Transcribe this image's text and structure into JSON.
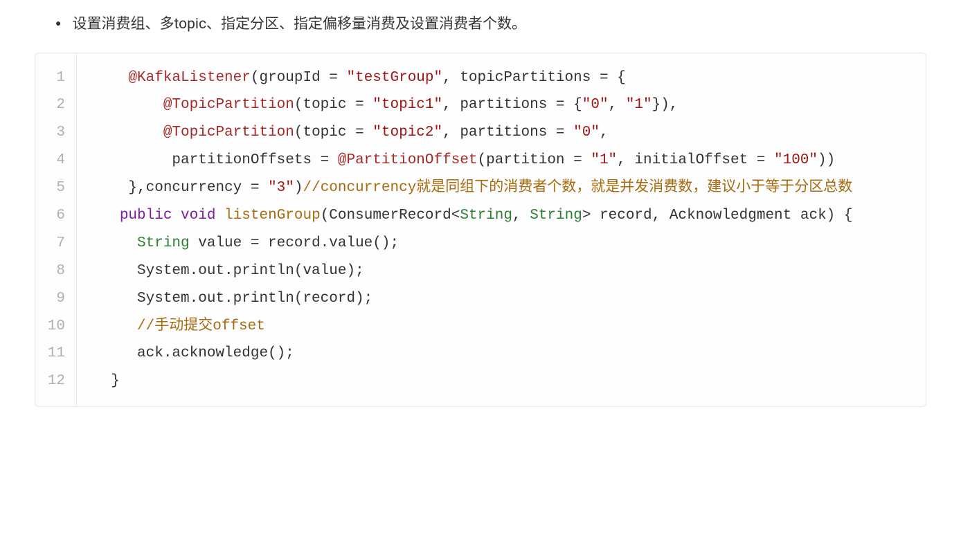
{
  "bullet_text": "设置消费组、多topic、指定分区、指定偏移量消费及设置消费者个数。",
  "code": {
    "line_numbers": [
      "1",
      "2",
      "3",
      "4",
      "5",
      "6",
      "7",
      "8",
      "9",
      "10",
      "11",
      "12"
    ],
    "lines": [
      [
        {
          "cls": "tk-plain",
          "text": "    "
        },
        {
          "cls": "tk-annotation",
          "text": "@KafkaListener"
        },
        {
          "cls": "tk-plain",
          "text": "(groupId = "
        },
        {
          "cls": "tk-string",
          "text": "\"testGroup\""
        },
        {
          "cls": "tk-plain",
          "text": ", topicPartitions = {"
        }
      ],
      [
        {
          "cls": "tk-plain",
          "text": "        "
        },
        {
          "cls": "tk-annotation",
          "text": "@TopicPartition"
        },
        {
          "cls": "tk-plain",
          "text": "(topic = "
        },
        {
          "cls": "tk-string",
          "text": "\"topic1\""
        },
        {
          "cls": "tk-plain",
          "text": ", partitions = {"
        },
        {
          "cls": "tk-string",
          "text": "\"0\""
        },
        {
          "cls": "tk-plain",
          "text": ", "
        },
        {
          "cls": "tk-string",
          "text": "\"1\""
        },
        {
          "cls": "tk-plain",
          "text": "}),"
        }
      ],
      [
        {
          "cls": "tk-plain",
          "text": "        "
        },
        {
          "cls": "tk-annotation",
          "text": "@TopicPartition"
        },
        {
          "cls": "tk-plain",
          "text": "(topic = "
        },
        {
          "cls": "tk-string",
          "text": "\"topic2\""
        },
        {
          "cls": "tk-plain",
          "text": ", partitions = "
        },
        {
          "cls": "tk-string",
          "text": "\"0\""
        },
        {
          "cls": "tk-plain",
          "text": ","
        }
      ],
      [
        {
          "cls": "tk-plain",
          "text": "         partitionOffsets = "
        },
        {
          "cls": "tk-annotation",
          "text": "@PartitionOffset"
        },
        {
          "cls": "tk-plain",
          "text": "(partition = "
        },
        {
          "cls": "tk-string",
          "text": "\"1\""
        },
        {
          "cls": "tk-plain",
          "text": ", initialOffset = "
        },
        {
          "cls": "tk-string",
          "text": "\"100\""
        },
        {
          "cls": "tk-plain",
          "text": "))"
        }
      ],
      [
        {
          "cls": "tk-plain",
          "text": "    },concurrency = "
        },
        {
          "cls": "tk-string",
          "text": "\"3\""
        },
        {
          "cls": "tk-plain",
          "text": ")"
        },
        {
          "cls": "tk-comment",
          "text": "//concurrency就是同组下的消费者个数，就是并发消费数，建议小于等于分区总数"
        }
      ],
      [
        {
          "cls": "tk-plain",
          "text": "   "
        },
        {
          "cls": "tk-keyword",
          "text": "public"
        },
        {
          "cls": "tk-plain",
          "text": " "
        },
        {
          "cls": "tk-keyword",
          "text": "void"
        },
        {
          "cls": "tk-plain",
          "text": " "
        },
        {
          "cls": "tk-method",
          "text": "listenGroup"
        },
        {
          "cls": "tk-plain",
          "text": "(ConsumerRecord<"
        },
        {
          "cls": "tk-type",
          "text": "String"
        },
        {
          "cls": "tk-plain",
          "text": ", "
        },
        {
          "cls": "tk-type",
          "text": "String"
        },
        {
          "cls": "tk-plain",
          "text": "> record, Acknowledgment ack) {"
        }
      ],
      [
        {
          "cls": "tk-plain",
          "text": "     "
        },
        {
          "cls": "tk-type",
          "text": "String"
        },
        {
          "cls": "tk-plain",
          "text": " value = record.value();"
        }
      ],
      [
        {
          "cls": "tk-plain",
          "text": "     System.out.println(value);"
        }
      ],
      [
        {
          "cls": "tk-plain",
          "text": "     System.out.println(record);"
        }
      ],
      [
        {
          "cls": "tk-plain",
          "text": "     "
        },
        {
          "cls": "tk-comment",
          "text": "//手动提交offset"
        }
      ],
      [
        {
          "cls": "tk-plain",
          "text": "     ack.acknowledge();"
        }
      ],
      [
        {
          "cls": "tk-plain",
          "text": "  }"
        }
      ]
    ]
  }
}
